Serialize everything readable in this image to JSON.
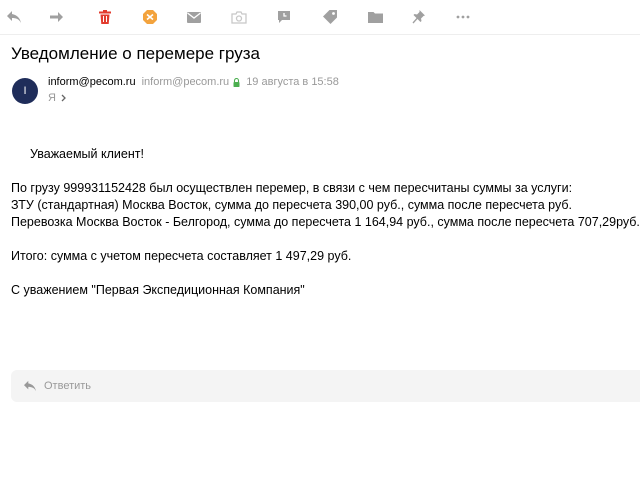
{
  "toolbar": {
    "buttons": [
      {
        "name": "reply-button",
        "icon": "reply-arrow-icon"
      },
      {
        "name": "forward-button",
        "icon": "forward-arrow-icon"
      },
      {
        "name": "delete-button",
        "icon": "trash-icon"
      },
      {
        "name": "spam-button",
        "icon": "spam-icon"
      },
      {
        "name": "mark-unread-button",
        "icon": "envelope-icon"
      },
      {
        "name": "block-button",
        "icon": "camera-icon"
      },
      {
        "name": "remind-button",
        "icon": "clock-bubble-icon"
      },
      {
        "name": "label-button",
        "icon": "tag-icon"
      },
      {
        "name": "move-to-folder-button",
        "icon": "folder-icon"
      },
      {
        "name": "pin-button",
        "icon": "pin-icon"
      },
      {
        "name": "more-button",
        "icon": "more-dots-icon"
      }
    ],
    "colors": {
      "default": "#a0a0a0",
      "delete": "#e23b2e",
      "spam": "#f3a33d",
      "lock": "#4caf50"
    }
  },
  "message": {
    "subject": "Уведомление о перемере груза",
    "sender": {
      "avatar_letter": "I",
      "name": "inform@pecom.ru",
      "email": "inform@pecom.ru",
      "time": "19 августа в 15:58"
    },
    "recipient": "Я",
    "body": {
      "greeting": "Уважаемый клиент!",
      "line1": "По грузу 999931152428 был осуществлен перемер, в связи с чем пересчитаны суммы за услуги:",
      "line2": "ЗТУ (стандартная) Москва Восток, сумма до пересчета 390,00 руб., сумма после пересчета руб.",
      "line3": "Перевозка Москва Восток - Белгород, сумма до пересчета 1 164,94 руб., сумма после пересчета 707,29руб.",
      "total": "Итого: сумма с учетом пересчета составляет 1 497,29 руб.",
      "signature": "С уважением \"Первая Экспедиционная Компания\""
    }
  },
  "reply": {
    "label": "Ответить"
  }
}
